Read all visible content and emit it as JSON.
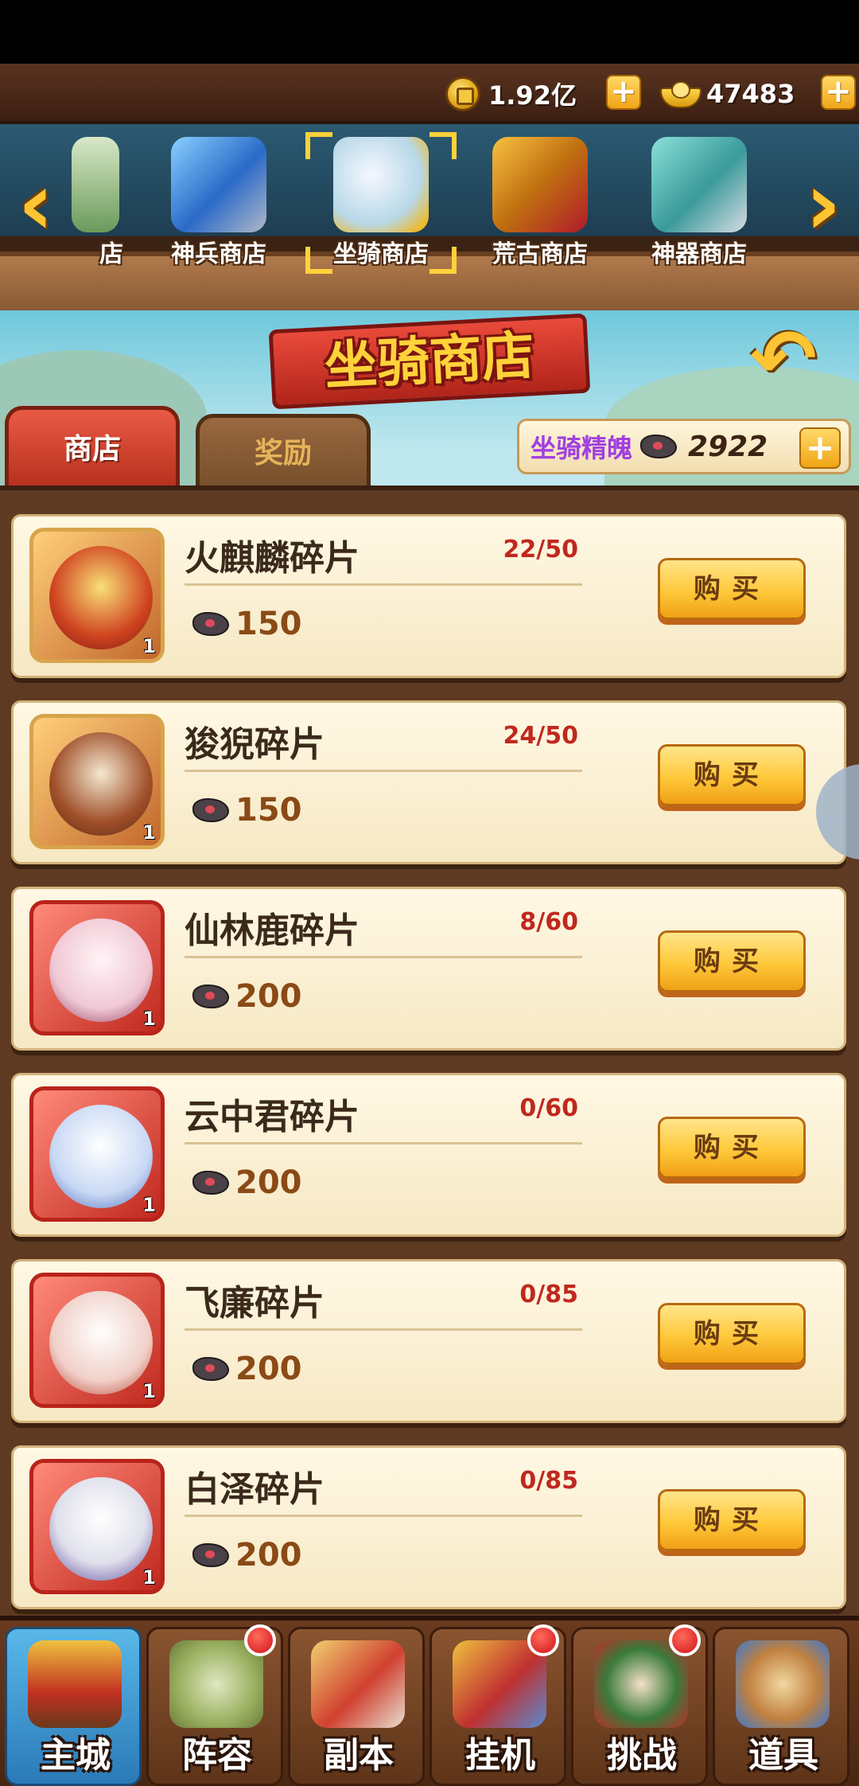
{
  "currency": {
    "coins_value": "1.92亿",
    "ingots_value": "47483"
  },
  "shop_tabs": [
    {
      "label": "店",
      "icon": "partial-shop-icon"
    },
    {
      "label": "神兵商店",
      "icon": "sword-icon"
    },
    {
      "label": "坐骑商店",
      "icon": "deer-mount-icon",
      "selected": true
    },
    {
      "label": "荒古商店",
      "icon": "ancient-relic-icon"
    },
    {
      "label": "神器商店",
      "icon": "artifact-icon"
    }
  ],
  "banner": {
    "title": "坐骑商店"
  },
  "sub_tabs": {
    "shop": "商店",
    "rewards": "奖励"
  },
  "essence": {
    "label": "坐骑精魄",
    "value": "2922"
  },
  "items": [
    {
      "name": "火麒麟碎片",
      "progress": "22/50",
      "price": "150",
      "count": "1",
      "frame": "gold"
    },
    {
      "name": "狻猊碎片",
      "progress": "24/50",
      "price": "150",
      "count": "1",
      "frame": "gold"
    },
    {
      "name": "仙林鹿碎片",
      "progress": "8/60",
      "price": "200",
      "count": "1",
      "frame": "red"
    },
    {
      "name": "云中君碎片",
      "progress": "0/60",
      "price": "200",
      "count": "1",
      "frame": "red"
    },
    {
      "name": "飞廉碎片",
      "progress": "0/85",
      "price": "200",
      "count": "1",
      "frame": "red"
    },
    {
      "name": "白泽碎片",
      "progress": "0/85",
      "price": "200",
      "count": "1",
      "frame": "red"
    }
  ],
  "buy_label": "购买",
  "bottom_nav": [
    {
      "label": "主城",
      "icon": "main-city-icon",
      "active": true,
      "badge": false
    },
    {
      "label": "阵容",
      "icon": "lineup-icon",
      "badge": true
    },
    {
      "label": "副本",
      "icon": "dungeon-icon",
      "badge": false
    },
    {
      "label": "挂机",
      "icon": "idle-icon",
      "badge": true
    },
    {
      "label": "挑战",
      "icon": "challenge-icon",
      "badge": true
    },
    {
      "label": "道具",
      "icon": "items-icon",
      "badge": false
    }
  ],
  "colors": {
    "accent_gold": "#ffc433",
    "progress_red": "#c0281e",
    "essence_purple": "#a040e0"
  }
}
